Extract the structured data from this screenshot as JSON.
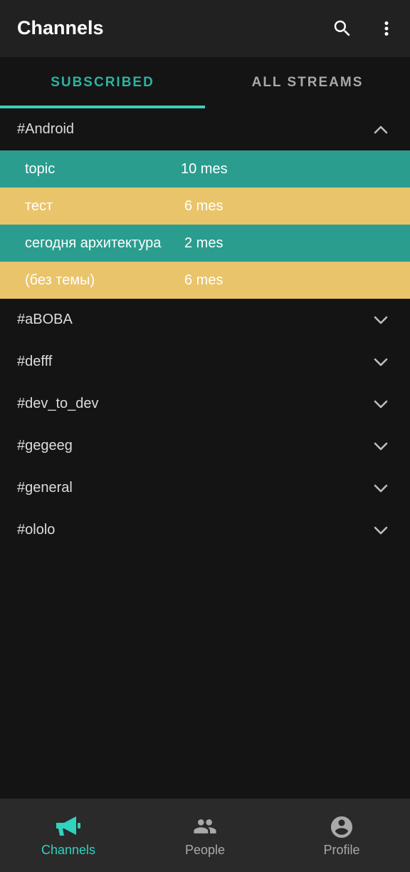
{
  "appbar": {
    "title": "Channels",
    "icons": [
      "search-icon",
      "more-vert-icon"
    ]
  },
  "tabs": [
    {
      "label": "SUBSCRIBED",
      "active": true
    },
    {
      "label": "ALL STREAMS",
      "active": false
    }
  ],
  "streams": [
    {
      "name": "#Android",
      "expanded": true,
      "topics": [
        {
          "name": "topic",
          "count": "10 mes",
          "color": "#2a9d8f"
        },
        {
          "name": "тест",
          "count": "6 mes",
          "color": "#e9c46a"
        },
        {
          "name": "сегодня архитектура",
          "count": "2 mes",
          "color": "#2a9d8f"
        },
        {
          "name": "(без темы)",
          "count": "6 mes",
          "color": "#e9c46a"
        }
      ]
    },
    {
      "name": "#aBOBA",
      "expanded": false
    },
    {
      "name": "#defff",
      "expanded": false
    },
    {
      "name": "#dev_to_dev",
      "expanded": false
    },
    {
      "name": "#gegeeg",
      "expanded": false
    },
    {
      "name": "#general",
      "expanded": false
    },
    {
      "name": "#ololo",
      "expanded": false
    }
  ],
  "bottom_nav": [
    {
      "label": "Channels",
      "icon": "megaphone-icon",
      "active": true
    },
    {
      "label": "People",
      "icon": "people-icon",
      "active": false
    },
    {
      "label": "Profile",
      "icon": "account-circle-icon",
      "active": false
    }
  ],
  "colors": {
    "accent": "#2bb3a0",
    "topic_teal": "#2a9d8f",
    "topic_yellow": "#e9c46a",
    "background": "#141414",
    "appbar": "#212121",
    "bottom_nav": "#2a2a2a"
  }
}
